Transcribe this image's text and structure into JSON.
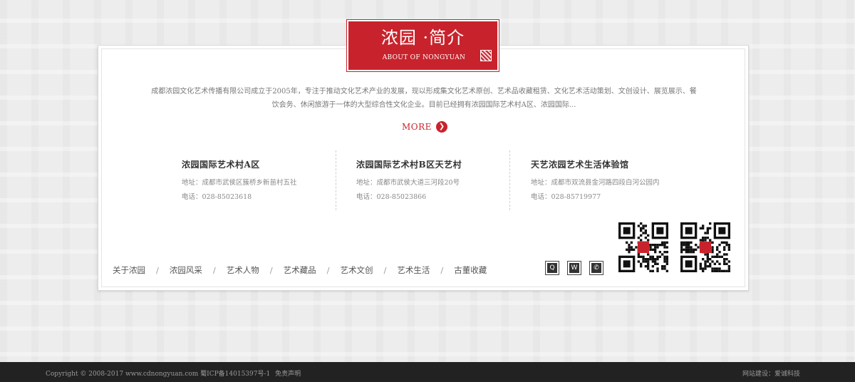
{
  "header": {
    "title": "浓园 ·简介",
    "subtitle": "ABOUT OF NONGYUAN"
  },
  "intro": {
    "text": "成都浓园文化艺术传播有限公司成立于2005年，专注于推动文化艺术产业的发展，现以形成集文化艺术原创、艺术品收藏租赁、文化艺术活动策划、文创设计、展览展示、餐饮会务、休闲旅游于一体的大型综合性文化企业。目前已经拥有浓园国际艺术村A区、浓园国际..."
  },
  "more": {
    "label": "MORE",
    "arrow": "❯"
  },
  "venues": [
    {
      "name": "浓园国际艺术村A区",
      "address": "地址：成都市武侯区簇桥乡新苗村五社",
      "phone": "电话：028-85023618"
    },
    {
      "name": "浓园国际艺术村B区天艺村",
      "address": "地址：成都市武侯大道三河段20号",
      "phone": "电话：028-85023866"
    },
    {
      "name": "天艺浓园艺术生活体验馆",
      "address": "地址：成都市双流县金河路四段白河公园内",
      "phone": "电话：028-85719977"
    }
  ],
  "nav": {
    "items": [
      "关于浓园",
      "浓园风采",
      "艺术人物",
      "艺术藏品",
      "艺术文创",
      "艺术生活",
      "古董收藏"
    ],
    "separator": "/"
  },
  "social": [
    {
      "icon": "qq-icon",
      "glyph": "Q"
    },
    {
      "icon": "weibo-icon",
      "glyph": "W"
    },
    {
      "icon": "wechat-icon",
      "glyph": "✆"
    }
  ],
  "footer": {
    "copyright": "Copyright © 2008-2017 www.cdnongyuan.com 蜀ICP备14015397号-1",
    "disclaimer": "免责声明",
    "builder": "网站建设：爱诚科技"
  },
  "colors": {
    "accent": "#c8232c",
    "footer_bg": "#222222"
  }
}
